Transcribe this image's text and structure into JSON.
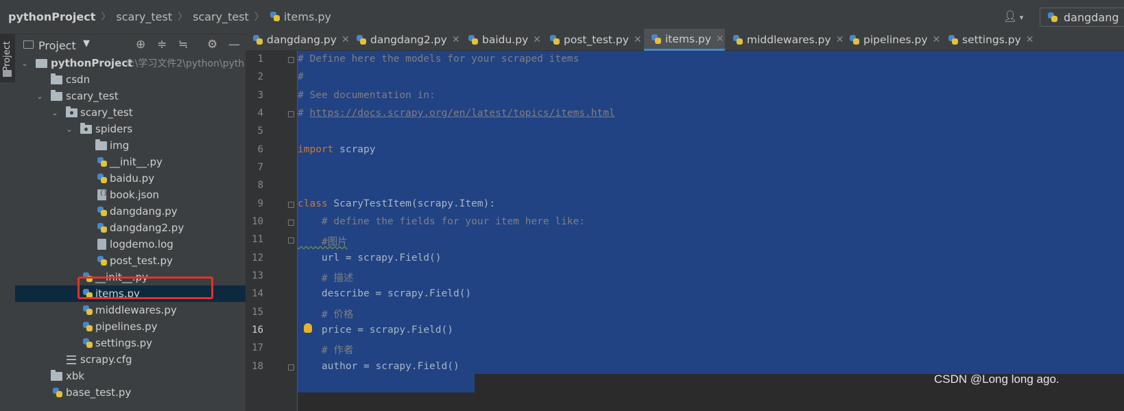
{
  "breadcrumb": {
    "items": [
      "pythonProject",
      "scary_test",
      "scary_test",
      "items.py"
    ]
  },
  "toolbar": {
    "user_icon": "user-icon",
    "run_config_label": "dangdang"
  },
  "sidebar": {
    "stripe_label": "Project"
  },
  "project_panel": {
    "title": "Project",
    "tools": [
      "target-icon",
      "expand-all-icon",
      "collapse-all-icon",
      "gear-icon",
      "minimize-icon"
    ],
    "tree": [
      {
        "label": "pythonProject",
        "path": "F:\\学习文件2\\python\\pyth",
        "kind": "root",
        "expanded": true
      },
      {
        "label": "csdn",
        "kind": "folder"
      },
      {
        "label": "scary_test",
        "kind": "folder",
        "expanded": true
      },
      {
        "label": "scary_test",
        "kind": "package",
        "expanded": true
      },
      {
        "label": "spiders",
        "kind": "package",
        "expanded": true
      },
      {
        "label": "img",
        "kind": "folder"
      },
      {
        "label": "__init__.py",
        "kind": "python"
      },
      {
        "label": "baidu.py",
        "kind": "python"
      },
      {
        "label": "book.json",
        "kind": "json"
      },
      {
        "label": "dangdang.py",
        "kind": "python"
      },
      {
        "label": "dangdang2.py",
        "kind": "python"
      },
      {
        "label": "logdemo.log",
        "kind": "file"
      },
      {
        "label": "post_test.py",
        "kind": "python"
      },
      {
        "label": "__init__.py",
        "kind": "python"
      },
      {
        "label": "items.py",
        "kind": "python",
        "selected": true
      },
      {
        "label": "middlewares.py",
        "kind": "python"
      },
      {
        "label": "pipelines.py",
        "kind": "python"
      },
      {
        "label": "settings.py",
        "kind": "python"
      },
      {
        "label": "scrapy.cfg",
        "kind": "config"
      },
      {
        "label": "xbk",
        "kind": "folder"
      },
      {
        "label": "base_test.py",
        "kind": "python"
      }
    ]
  },
  "tabs": [
    {
      "label": "dangdang.py",
      "active": false
    },
    {
      "label": "dangdang2.py",
      "active": false
    },
    {
      "label": "baidu.py",
      "active": false
    },
    {
      "label": "post_test.py",
      "active": false
    },
    {
      "label": "items.py",
      "active": true
    },
    {
      "label": "middlewares.py",
      "active": false
    },
    {
      "label": "pipelines.py",
      "active": false
    },
    {
      "label": "settings.py",
      "active": false
    }
  ],
  "editor": {
    "current_line": 16,
    "lines": [
      {
        "n": "1",
        "code": "# Define here the models for your scraped items"
      },
      {
        "n": "2",
        "code": "#"
      },
      {
        "n": "3",
        "code": "# See documentation in:"
      },
      {
        "n": "4",
        "code_prefix": "# ",
        "code_url": "https://docs.scrapy.org/en/latest/topics/items.html"
      },
      {
        "n": "5",
        "code": ""
      },
      {
        "n": "6",
        "kw": "import",
        "code": " scrapy"
      },
      {
        "n": "7",
        "code": ""
      },
      {
        "n": "8",
        "code": ""
      },
      {
        "n": "9",
        "kw": "class",
        "code": " ScaryTestItem(scrapy.Item):"
      },
      {
        "n": "10",
        "code": "    # define the fields for your item here like:"
      },
      {
        "n": "11",
        "code": "    #图片"
      },
      {
        "n": "12",
        "code": "    url = scrapy.Field()"
      },
      {
        "n": "13",
        "code": "    # 描述"
      },
      {
        "n": "14",
        "code": "    describe = scrapy.Field()"
      },
      {
        "n": "15",
        "code": "    # 价格"
      },
      {
        "n": "16",
        "code": "    price = scrapy.Field()"
      },
      {
        "n": "17",
        "code": "    # 作者"
      },
      {
        "n": "18",
        "code": "    author = scrapy.Field()"
      }
    ]
  },
  "watermark": "CSDN @Long long ago."
}
